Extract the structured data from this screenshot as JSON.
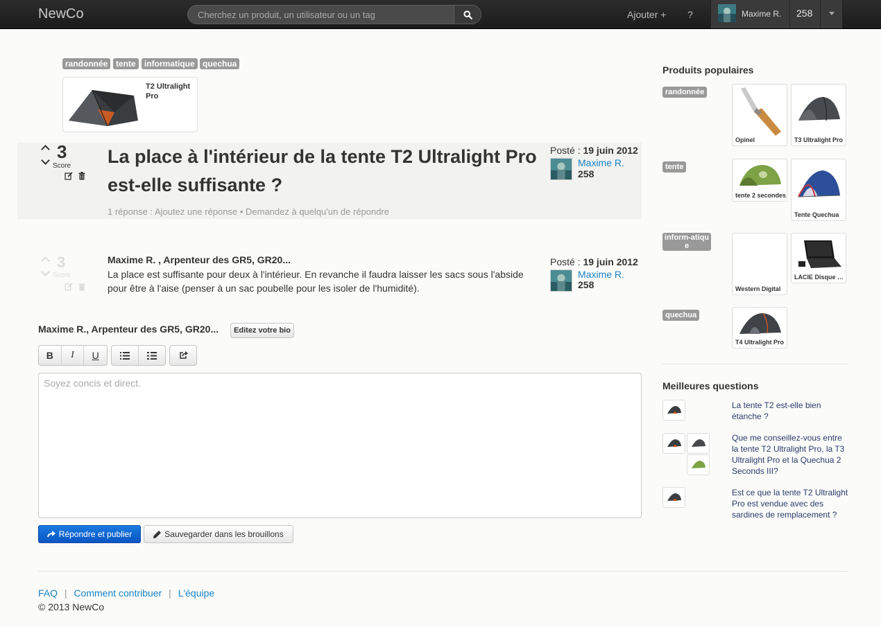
{
  "header": {
    "brand": "NewCo",
    "search_placeholder": "Cherchez un produit, un utilisateur ou un tag",
    "add_label": "Ajouter +",
    "help_label": "?",
    "user_name": "Maxime R.",
    "user_score": "258"
  },
  "question": {
    "tags": [
      "randonnée",
      "tente",
      "informatique",
      "quechua"
    ],
    "product_name": "T2 Ultralight Pro",
    "score": "3",
    "score_label": "Score",
    "title": "La place à l'intérieur de la tente T2 Ultralight Pro est-elle suffisante ?",
    "meta": {
      "replies": "1 réponse",
      "add_reply": "Ajoutez une réponse",
      "ask_someone": "Demandez à quelqu'un de répondre"
    },
    "posted_prefix": "Posté : ",
    "posted_date": "19 juin 2012",
    "author": "Maxime R.",
    "author_score": "258"
  },
  "answer": {
    "score": "3",
    "score_label": "Score",
    "author_line": "Maxime R. , Arpenteur des GR5, GR20...",
    "body": "La place est suffisante pour deux à l'intérieur. En revanche il faudra laisser les sacs sous l'abside pour être à l'aise (penser à un sac poubelle pour les isoler de l'humidité).",
    "posted_prefix": "Posté : ",
    "posted_date": "19 juin 2012",
    "author": "Maxime R.",
    "author_score": "258"
  },
  "editor": {
    "name_line": "Maxime R., Arpenteur des GR5, GR20...",
    "edit_bio": "Editez votre bio",
    "toolbar": {
      "bold": "B",
      "italic": "I",
      "underline": "U"
    },
    "placeholder": "Soyez concis et direct.",
    "submit": "Répondre et publier",
    "save_draft": "Sauvegarder dans les brouillons"
  },
  "sidebar": {
    "popular_title": "Produits populaires",
    "groups": [
      {
        "tag": "randonnée",
        "products": [
          "Opinel",
          "T3 Ultralight Pro"
        ]
      },
      {
        "tag": "tente",
        "products": [
          "tente 2 secondes",
          "Tente Quechua"
        ]
      },
      {
        "tag": "inform-atique",
        "products": [
          "Western Digital",
          "LACIE Disque dur"
        ]
      },
      {
        "tag": "quechua",
        "products": [
          "T4 Ultralight Pro"
        ]
      }
    ],
    "best_title": "Meilleures questions",
    "best_questions": [
      "La tente T2 est-elle bien étanche ?",
      "Que me conseillez-vous entre la tente T2 Ultralight Pro, la T3 Ultralight Pro et la Quechua 2 Seconds III?",
      "Est ce que la tente T2 Ultralight Pro est vendue avec des sardines de remplacement ?"
    ]
  },
  "footer": {
    "links": [
      "FAQ",
      "Comment contribuer",
      "L'équipe"
    ],
    "separator": "|",
    "copyright": "© 2013 NewCo"
  },
  "colors": {
    "link": "#1a82c3",
    "primary": "#0a56c4",
    "topbar": "#1b1b1b",
    "tag": "#999999"
  }
}
